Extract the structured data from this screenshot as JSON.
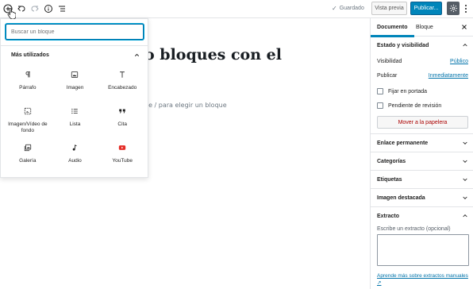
{
  "toolbar": {
    "saved_label": "Guardado",
    "preview_label": "Vista previa",
    "publish_label": "Publicar..."
  },
  "editor": {
    "title_fragment": "o bloques con el",
    "appender_fragment": "be / para elegir un bloque"
  },
  "inserter": {
    "search_placeholder": "Buscar un bloque",
    "section_title": "Más utilizados",
    "blocks": [
      {
        "label": "Párrafo",
        "icon": "paragraph-icon"
      },
      {
        "label": "Imagen",
        "icon": "image-icon"
      },
      {
        "label": "Encabezado",
        "icon": "heading-icon"
      },
      {
        "label": "Imagen/Vídeo de fondo",
        "icon": "cover-icon"
      },
      {
        "label": "Lista",
        "icon": "list-icon"
      },
      {
        "label": "Cita",
        "icon": "quote-icon"
      },
      {
        "label": "Galería",
        "icon": "gallery-icon"
      },
      {
        "label": "Audio",
        "icon": "audio-icon"
      },
      {
        "label": "YouTube",
        "icon": "youtube-icon"
      }
    ]
  },
  "sidebar": {
    "tabs": {
      "document": "Documento",
      "block": "Bloque"
    },
    "status": {
      "title": "Estado y visibilidad",
      "visibility_label": "Visibilidad",
      "visibility_value": "Público",
      "publish_label": "Publicar",
      "publish_value": "Inmediatamente",
      "sticky_label": "Fijar en portada",
      "pending_label": "Pendiente de revisión",
      "trash_label": "Mover a la papelera"
    },
    "panels": [
      "Enlace permanente",
      "Categorías",
      "Etiquetas",
      "Imagen destacada"
    ],
    "excerpt": {
      "title": "Extracto",
      "field_label": "Escribe un extracto (opcional)",
      "help_link": "Aprende más sobre extractos manuales"
    }
  },
  "colors": {
    "accent": "#0085ba",
    "link": "#0073aa",
    "danger": "#aa0000"
  }
}
